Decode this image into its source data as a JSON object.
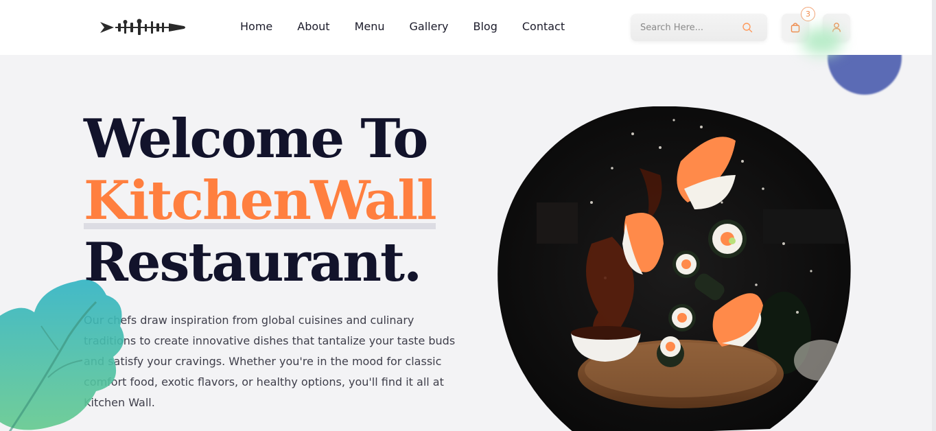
{
  "nav": {
    "items": [
      "Home",
      "About",
      "Menu",
      "Gallery",
      "Blog",
      "Contact"
    ]
  },
  "search": {
    "placeholder": "Search Here..."
  },
  "cart": {
    "count": "3"
  },
  "hero": {
    "title_line1": "Welcome To",
    "title_accent": "KitchenWall",
    "title_line3": "Restaurant.",
    "description": "Our chefs draw inspiration from global cuisines and culinary traditions to create innovative dishes that tantalize your taste buds and satisfy your cravings. Whether you're in the mood for classic comfort food, exotic flavors, or healthy options, you'll find it all at Kitchen Wall."
  },
  "colors": {
    "accent": "#ff7f3f",
    "title": "#12132b",
    "background": "#f3f3f5",
    "blob_blue": "#5b6bb5",
    "leaf_teal": "#2fb3c3"
  },
  "icons": {
    "logo": "utensils-logo",
    "search": "search-icon",
    "cart": "shopping-bag-icon",
    "user": "user-icon"
  }
}
